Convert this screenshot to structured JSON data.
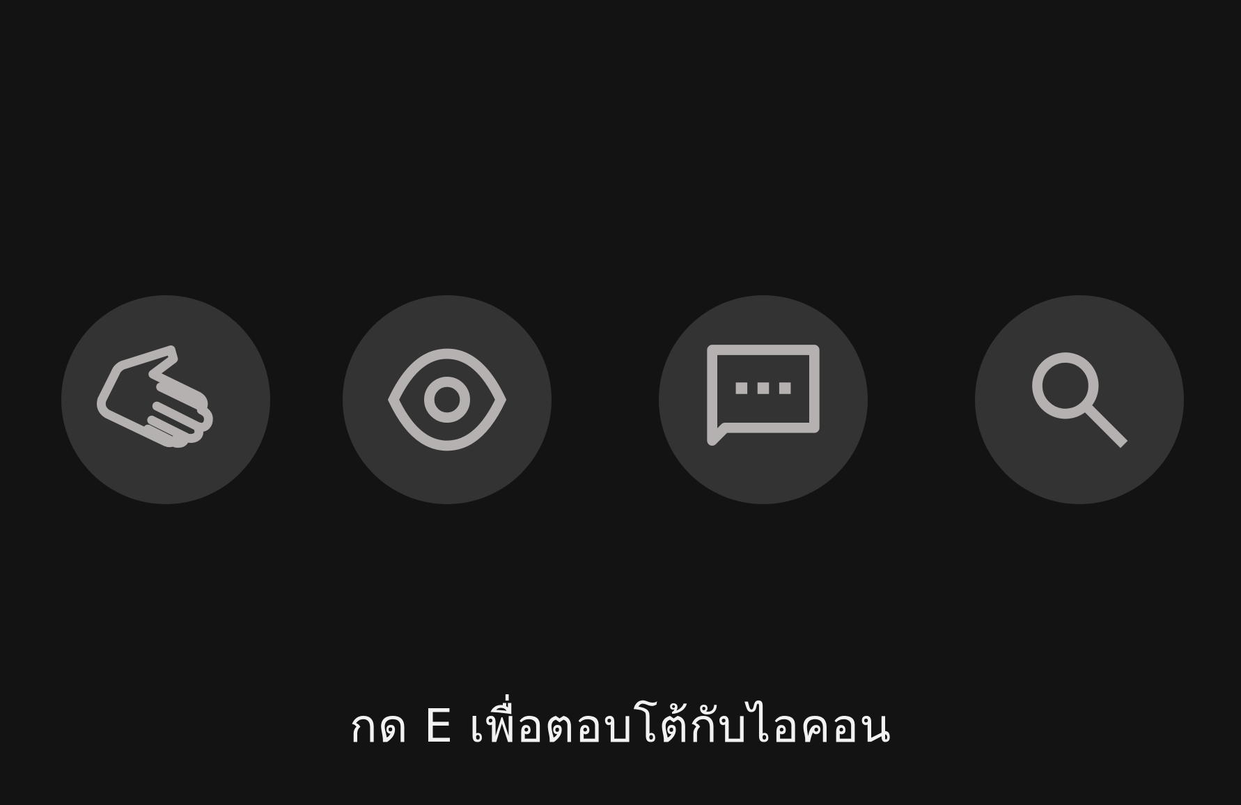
{
  "interaction_prompt": {
    "text": "กด E เพื่อตอบโต้กับไอคอน"
  },
  "icons": [
    {
      "name": "hand-icon"
    },
    {
      "name": "eye-icon"
    },
    {
      "name": "chat-bubble-icon"
    },
    {
      "name": "search-icon"
    }
  ],
  "colors": {
    "background": "#131313",
    "circle": "#333333",
    "icon": "#b5b1b0",
    "text": "#f2f2f2"
  }
}
